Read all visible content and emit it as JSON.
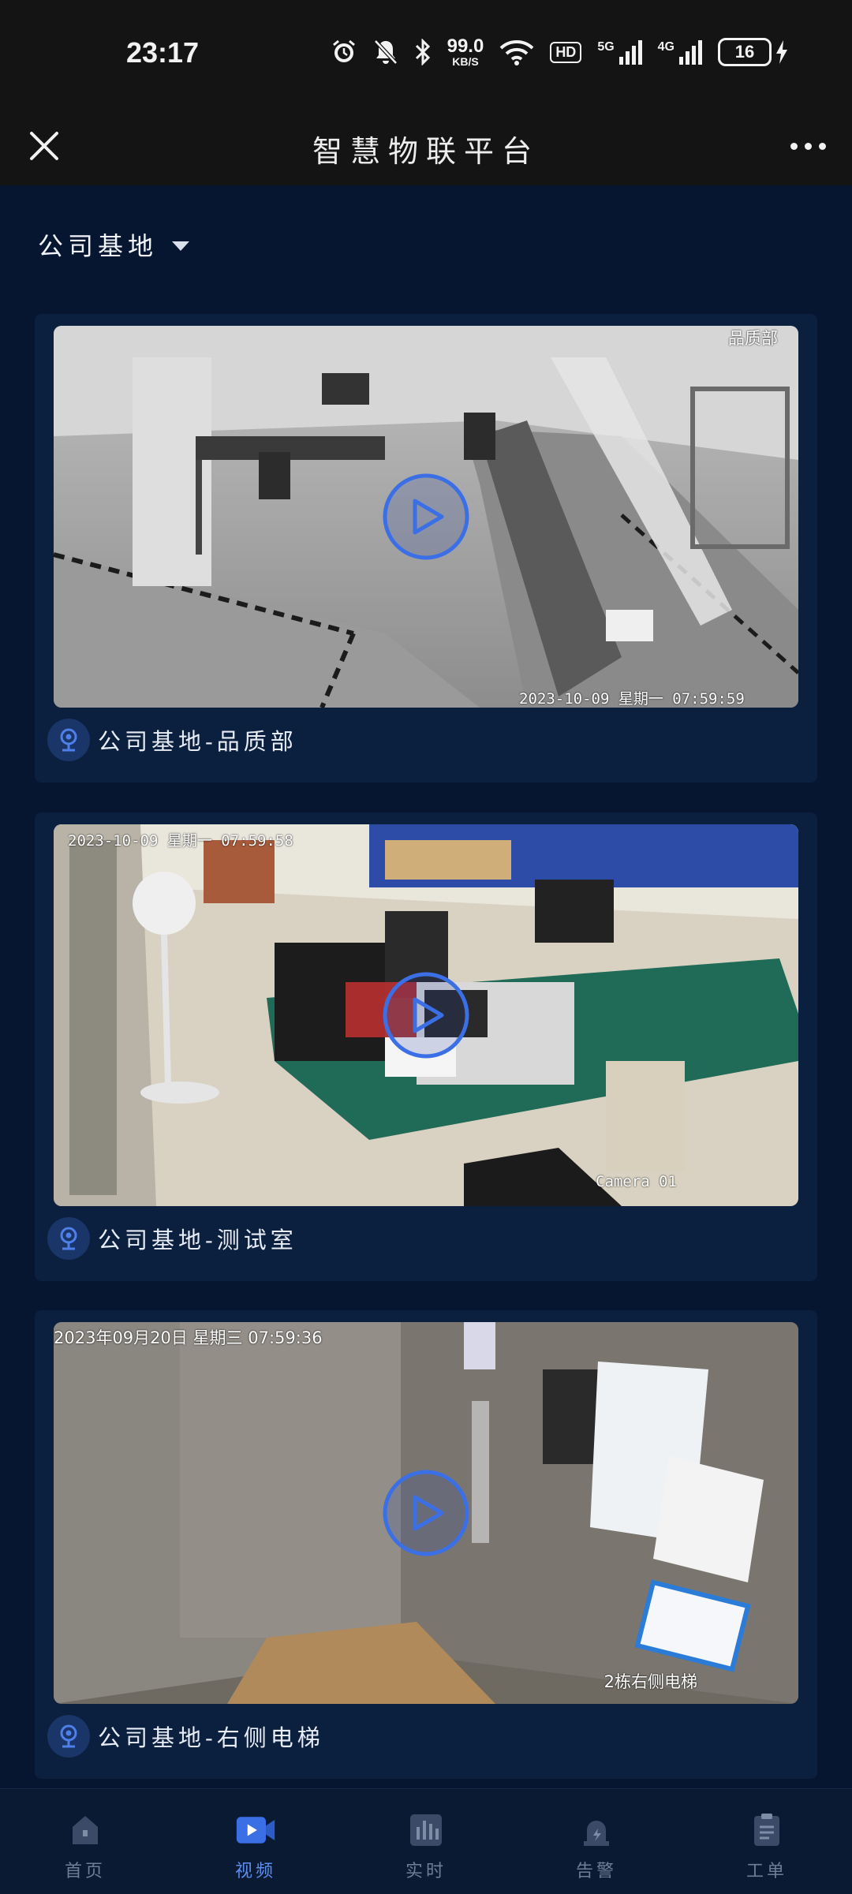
{
  "status_bar": {
    "time": "23:17",
    "net_speed_value": "99.0",
    "net_speed_unit": "KB/S",
    "hd_label": "HD",
    "signal_1_label": "5G",
    "signal_2_label": "4G",
    "battery_level": "16",
    "icons": [
      "alarm-icon",
      "mute-icon",
      "bluetooth-icon",
      "wifi-icon",
      "charging-icon"
    ]
  },
  "app_bar": {
    "title": "智慧物联平台"
  },
  "location": {
    "selected": "公司基地"
  },
  "cameras": [
    {
      "name": "公司基地-品质部",
      "osd_top_right": "品质部",
      "osd_bottom": "2023-10-09 星期一 07:59:59"
    },
    {
      "name": "公司基地-测试室",
      "osd_top_left": "2023-10-09 星期一 07:59:58",
      "osd_bottom_right": "Camera 01"
    },
    {
      "name": "公司基地-右侧电梯",
      "osd_top_left": "2023年09月20日 星期三 07:59:36",
      "osd_bottom_right": "2栋右侧电梯"
    }
  ],
  "bottom_nav": {
    "items": [
      {
        "label": "首页",
        "icon": "home-icon",
        "active": false
      },
      {
        "label": "视频",
        "icon": "video-icon",
        "active": true
      },
      {
        "label": "实时",
        "icon": "realtime-chart-icon",
        "active": false
      },
      {
        "label": "告警",
        "icon": "alarm-siren-icon",
        "active": false
      },
      {
        "label": "工单",
        "icon": "clipboard-icon",
        "active": false
      }
    ]
  },
  "colors": {
    "accent": "#3b6fe6",
    "background": "#061530",
    "card": "#0b1f3f"
  }
}
